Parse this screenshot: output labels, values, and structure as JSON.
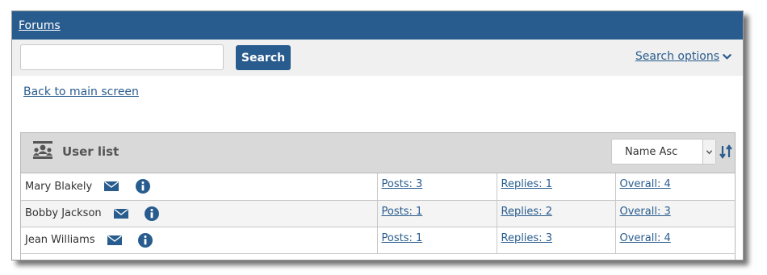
{
  "topbar": {
    "forums_link": "Forums"
  },
  "search": {
    "input_value": "",
    "button_label": "Search",
    "options_label": "Search options"
  },
  "back_link": "Back to main screen",
  "user_list": {
    "title": "User list",
    "sort_value": "Name Asc",
    "rows": [
      {
        "name": "Mary Blakely",
        "posts": "Posts: 3",
        "replies": "Replies: 1",
        "overall": "Overall: 4"
      },
      {
        "name": "Bobby Jackson",
        "posts": "Posts: 1",
        "replies": "Replies: 2",
        "overall": "Overall: 3"
      },
      {
        "name": "Jean Williams",
        "posts": "Posts: 1",
        "replies": "Replies: 3",
        "overall": "Overall: 4"
      }
    ]
  },
  "colors": {
    "brand_blue": "#295c8e",
    "header_gray": "#d9d9d9"
  }
}
